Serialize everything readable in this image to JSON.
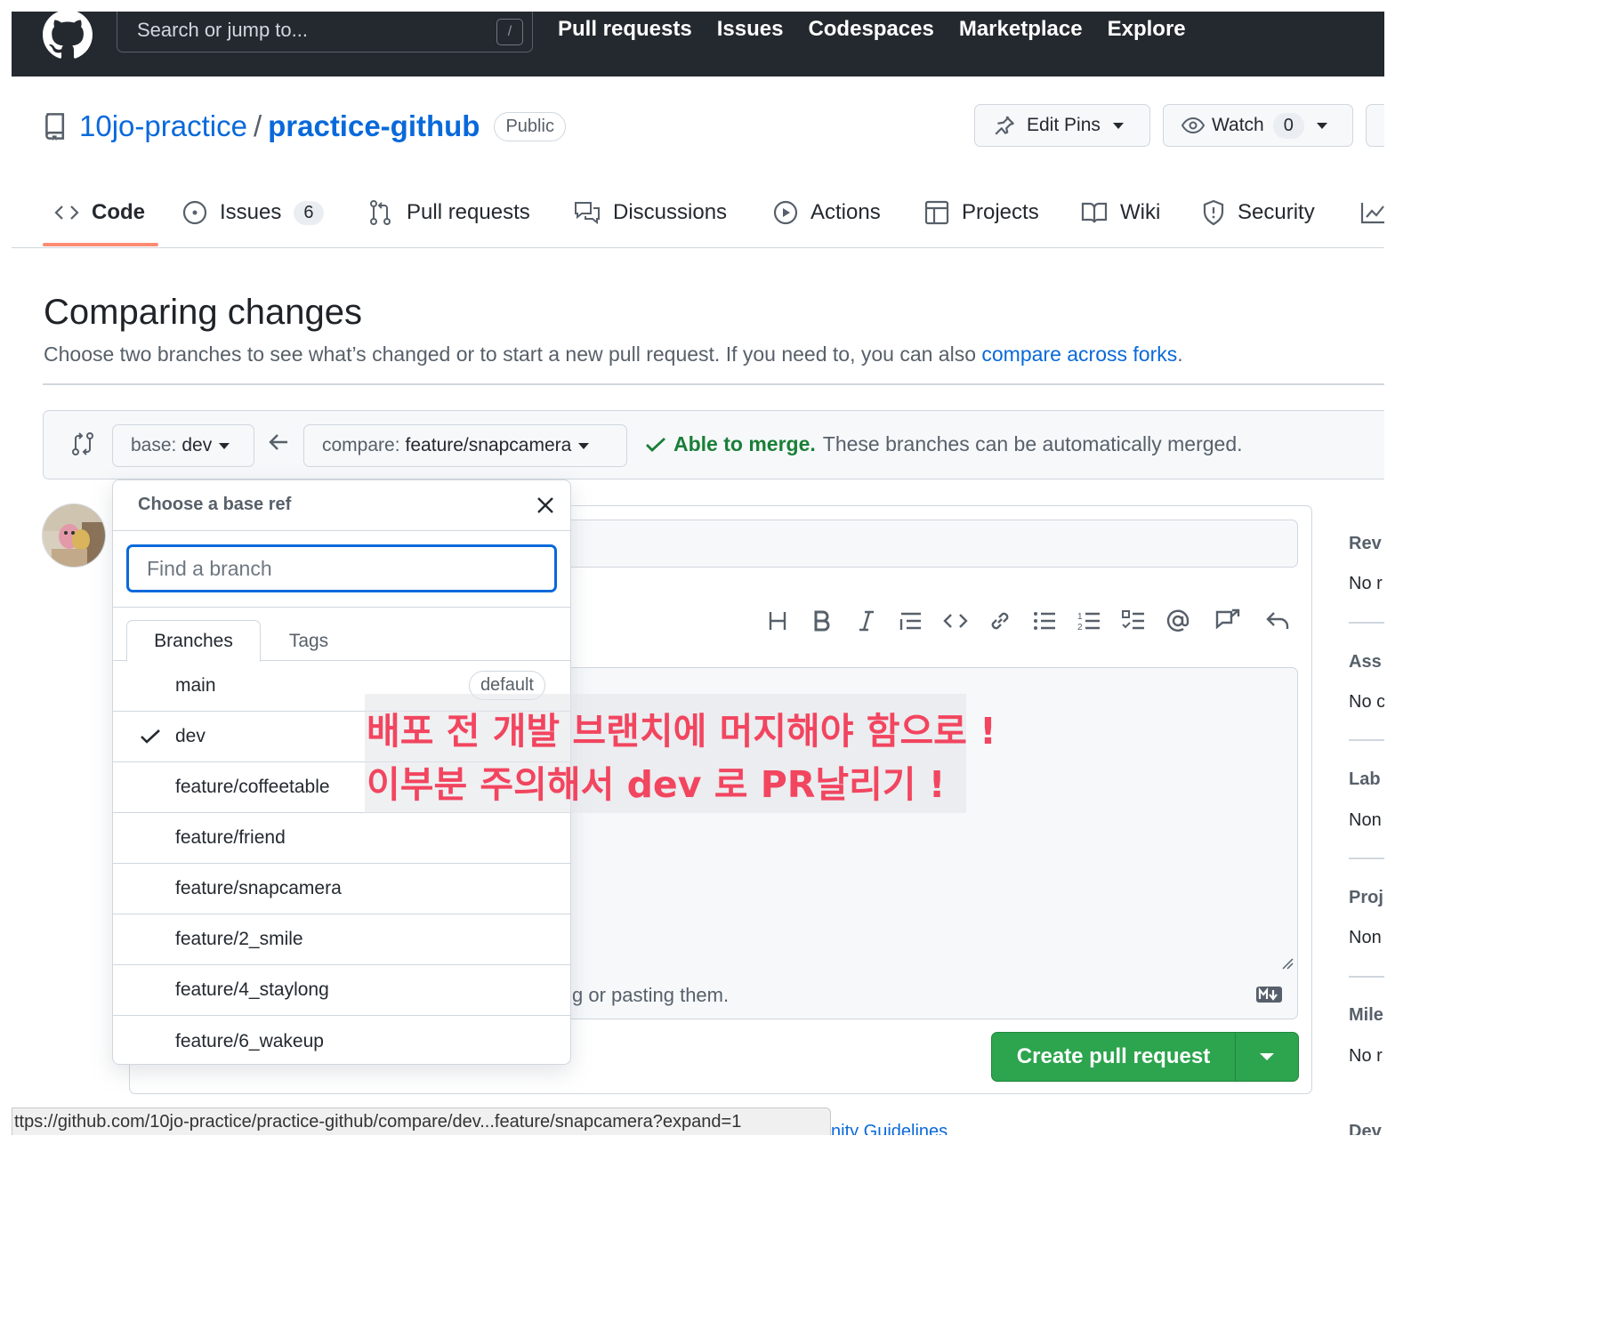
{
  "header": {
    "search_placeholder": "Search or jump to...",
    "search_key": "/",
    "nav": [
      "Pull requests",
      "Issues",
      "Codespaces",
      "Marketplace",
      "Explore"
    ]
  },
  "repo": {
    "owner": "10jo-practice",
    "separator": "/",
    "name": "practice-github",
    "visibility": "Public",
    "edit_pins": "Edit Pins",
    "watch": "Watch",
    "watch_count": "0"
  },
  "tabs": {
    "code": "Code",
    "issues": "Issues",
    "issues_count": "6",
    "pull_requests": "Pull requests",
    "discussions": "Discussions",
    "actions": "Actions",
    "projects": "Projects",
    "wiki": "Wiki",
    "security": "Security"
  },
  "compare": {
    "title": "Comparing changes",
    "subtitle_prefix": "Choose two branches to see what’s changed or to start a new pull request. If you need to, you can also ",
    "subtitle_link": "compare across forks",
    "subtitle_suffix": ".",
    "base_label": "base:",
    "base_value": "dev",
    "compare_label": "compare:",
    "compare_value": "feature/snapcamera",
    "merge_ok": "Able to merge.",
    "merge_text": "These branches can be automatically merged."
  },
  "composer": {
    "drop_hint": "g or pasting them.",
    "create_button": "Create pull request"
  },
  "sidebar": {
    "reviewers": "Rev",
    "reviewers_value": "No r",
    "assignees": "Ass",
    "assignees_value": "No c",
    "labels": "Lab",
    "labels_value": "Non",
    "projects": "Proj",
    "projects_value": "Non",
    "milestone": "Mile",
    "milestone_value": "No r",
    "development": "Dev"
  },
  "dropdown": {
    "title": "Choose a base ref",
    "filter_placeholder": "Find a branch",
    "tab_branches": "Branches",
    "tab_tags": "Tags",
    "default_badge": "default",
    "branches": [
      "main",
      "dev",
      "feature/coffeetable",
      "feature/friend",
      "feature/snapcamera",
      "feature/2_smile",
      "feature/4_staylong",
      "feature/6_wakeup"
    ],
    "selected": "dev"
  },
  "annotation": {
    "line1": "배포 전 개발 브랜치에 머지해야 함으로 !",
    "line2": "이부분 주의해서 dev 로 PR날리기 !"
  },
  "statusbar": {
    "url": "ttps://github.com/10jo-practice/practice-github/compare/dev...feature/snapcamera?expand=1",
    "behind_text": "nity Guidelines"
  },
  "colors": {
    "header_bg": "#24292f",
    "link": "#0969da",
    "success": "#1a7f37",
    "primary_button": "#2da44e",
    "tab_underline": "#fd8c73",
    "annotation": "#f2455f"
  }
}
